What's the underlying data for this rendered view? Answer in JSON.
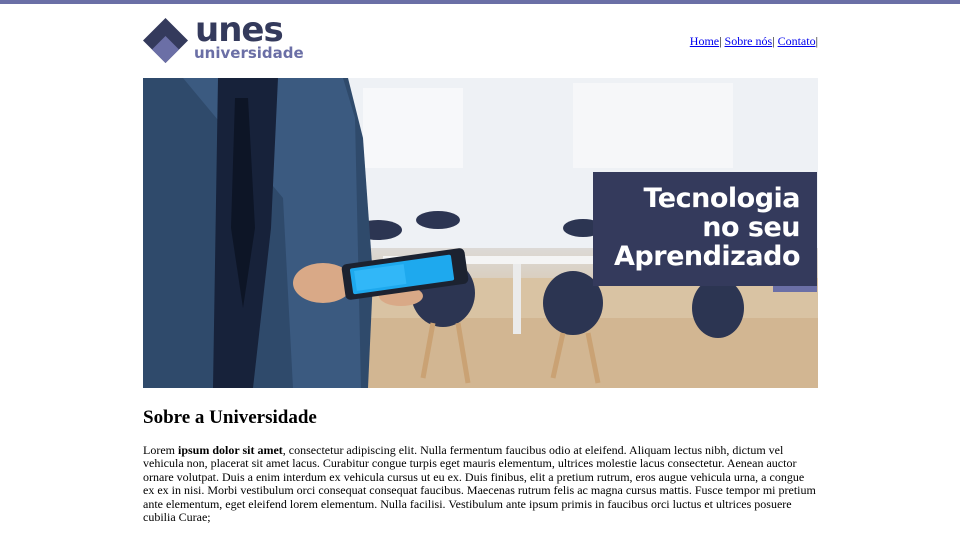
{
  "brand": {
    "name": "unes",
    "sub": "universidade",
    "colors": {
      "primary": "#343a5c",
      "accent": "#6b6fa6"
    }
  },
  "nav": {
    "items": [
      {
        "label": "Home"
      },
      {
        "label": "Sobre nós"
      },
      {
        "label": "Contato"
      }
    ],
    "separator": "|"
  },
  "hero": {
    "lines": [
      "Tecnologia",
      "no seu",
      "Aprendizado"
    ]
  },
  "about": {
    "title": "Sobre a Universidade",
    "lead_plain": "Lorem ",
    "lead_bold": "ipsum dolor sit amet",
    "text": ", consectetur adipiscing elit. Nulla fermentum faucibus odio at eleifend. Aliquam lectus nibh, dictum vel vehicula non, placerat sit amet lacus. Curabitur congue turpis eget mauris elementum, ultrices molestie lacus consectetur. Aenean auctor ornare volutpat. Duis a enim interdum ex vehicula cursus ut eu ex. Duis finibus, elit a pretium rutrum, eros augue vehicula urna, a congue ex ex in nisi. Morbi vestibulum orci consequat consequat faucibus. Maecenas rutrum felis ac magna cursus mattis. Fusce tempor mi pretium ante elementum, eget eleifend lorem elementum. Nulla facilisi. Vestibulum ante ipsum primis in faucibus orci luctus et ultrices posuere cubilia Curae;"
  }
}
